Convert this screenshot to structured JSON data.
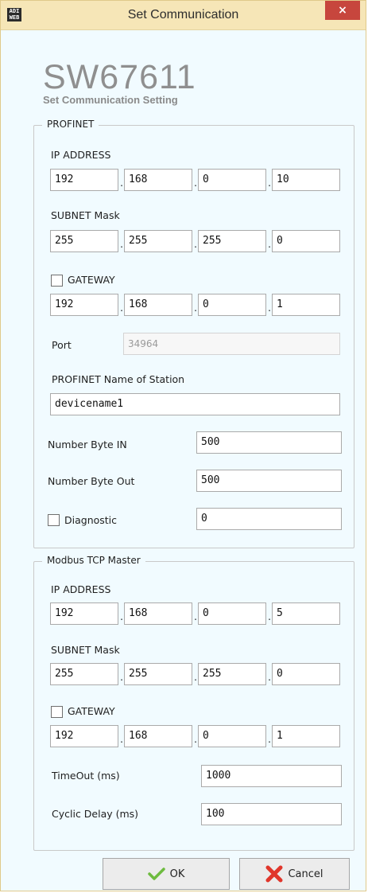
{
  "window": {
    "title": "Set Communication",
    "close_glyph": "×",
    "icon_text": "ADI\nWEB"
  },
  "header": {
    "product": "SW67611",
    "subtitle": "Set Communication Setting"
  },
  "profinet": {
    "legend": "PROFINET",
    "ip_label": "IP ADDRESS",
    "ip": [
      "192",
      "168",
      "0",
      "10"
    ],
    "subnet_label": "SUBNET Mask",
    "subnet": [
      "255",
      "255",
      "255",
      "0"
    ],
    "gateway_label": "GATEWAY",
    "gateway_checked": false,
    "gateway": [
      "192",
      "168",
      "0",
      "1"
    ],
    "port_label": "Port",
    "port_value": "34964",
    "name_label": "PROFINET Name of Station",
    "name_value": "devicename1",
    "byte_in_label": "Number Byte IN",
    "byte_in_value": "500",
    "byte_out_label": "Number Byte Out",
    "byte_out_value": "500",
    "diagnostic_label": "Diagnostic",
    "diagnostic_checked": false,
    "diagnostic_value": "0"
  },
  "modbus": {
    "legend": "Modbus TCP Master",
    "ip_label": "IP ADDRESS",
    "ip": [
      "192",
      "168",
      "0",
      "5"
    ],
    "subnet_label": "SUBNET Mask",
    "subnet": [
      "255",
      "255",
      "255",
      "0"
    ],
    "gateway_label": "GATEWAY",
    "gateway_checked": false,
    "gateway": [
      "192",
      "168",
      "0",
      "1"
    ],
    "timeout_label": "TimeOut (ms)",
    "timeout_value": "1000",
    "cyclic_label": "Cyclic Delay (ms)",
    "cyclic_value": "100"
  },
  "buttons": {
    "ok_label": "OK",
    "cancel_label": "Cancel"
  },
  "colors": {
    "titlebar": "#f6e6b7",
    "close": "#c7463d",
    "background": "#f1fbff",
    "ok_check": "#6dbb3f",
    "cancel_x": "#e0362b"
  },
  "icons": {
    "app": "adi-web-logo-icon",
    "ok": "green-check-icon",
    "cancel": "red-x-icon"
  }
}
